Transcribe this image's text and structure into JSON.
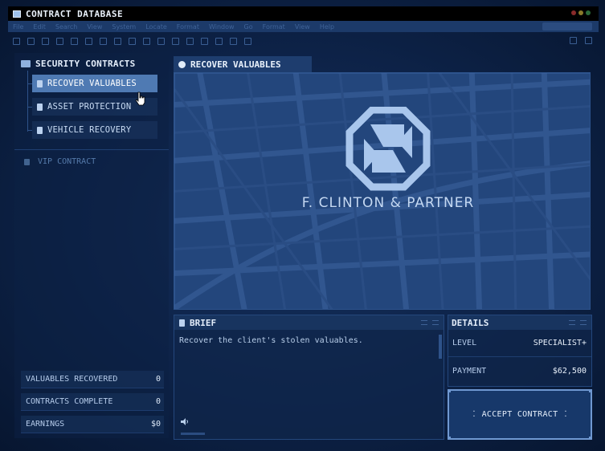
{
  "window": {
    "title": "CONTRACT DATABASE",
    "window_controls": [
      "#8a2a2a",
      "#8a7a2a",
      "#2a6a3a"
    ]
  },
  "menu": {
    "items": [
      "File",
      "Edit",
      "Search",
      "View",
      "System",
      "Locate",
      "Format",
      "Window",
      "Go",
      "Format",
      "View",
      "Help"
    ]
  },
  "sidebar": {
    "header": "SECURITY CONTRACTS",
    "items": [
      {
        "label": "RECOVER VALUABLES"
      },
      {
        "label": "ASSET PROTECTION"
      },
      {
        "label": "VEHICLE RECOVERY"
      }
    ],
    "locked_item": "VIP CONTRACT",
    "stats": [
      {
        "label": "VALUABLES RECOVERED",
        "value": "0"
      },
      {
        "label": "CONTRACTS COMPLETE",
        "value": "0"
      },
      {
        "label": "EARNINGS",
        "value": "$0"
      }
    ]
  },
  "main_tab": {
    "label": "RECOVER VALUABLES"
  },
  "map": {
    "logo_text": "F. CLINTON & PARTNER"
  },
  "brief": {
    "title": "BRIEF",
    "text": "Recover the client's stolen valuables."
  },
  "details": {
    "title": "DETAILS",
    "rows": [
      {
        "label": "LEVEL",
        "value": "SPECIALIST+"
      },
      {
        "label": "PAYMENT",
        "value": "$62,500"
      }
    ]
  },
  "accept_button": {
    "label": "ACCEPT CONTRACT"
  },
  "colors": {
    "background": "#0d2247",
    "accent": "#4f7ab3",
    "panel": "#18345f",
    "map": "#23467c"
  }
}
